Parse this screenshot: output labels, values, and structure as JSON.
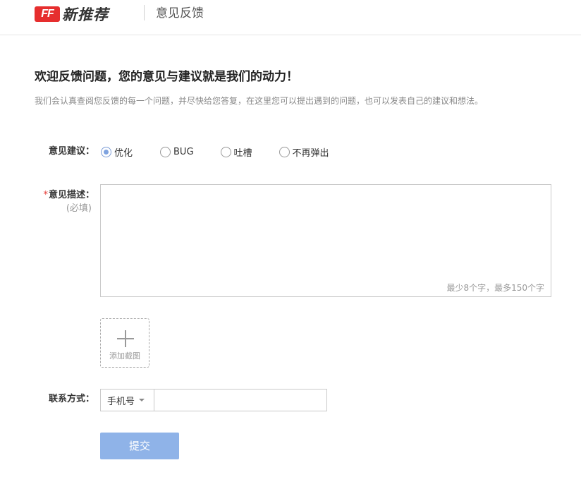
{
  "header": {
    "logo_mark": "FF",
    "logo_text": "新推荐",
    "title": "意见反馈"
  },
  "welcome": {
    "title": "欢迎反馈问题，您的意见与建议就是我们的动力！",
    "description": "我们会认真查阅您反馈的每一个问题，并尽快给您答复，在这里您可以提出遇到的问题，也可以发表自己的建议和想法。"
  },
  "form": {
    "suggestion_label": "意见建议：",
    "options": [
      {
        "label": "优化",
        "checked": true
      },
      {
        "label": "BUG",
        "checked": false
      },
      {
        "label": "吐槽",
        "checked": false
      },
      {
        "label": "不再弹出",
        "checked": false
      }
    ],
    "description_required_mark": "*",
    "description_label": "意见描述：",
    "description_required_text": "(必填)",
    "description_value": "",
    "description_hint": "最少8个字，最多150个字",
    "upload_label": "添加截图",
    "contact_label": "联系方式：",
    "contact_type": "手机号",
    "contact_value": "",
    "submit_label": "提交"
  },
  "colors": {
    "brand_red": "#e62e2e",
    "radio_checked": "#7fa3e0",
    "submit_bg": "#8fb3e8",
    "required": "#e53935"
  },
  "icons": {
    "logo": "ff-logo-icon",
    "upload": "plus-icon",
    "dropdown": "caret-down-icon"
  }
}
